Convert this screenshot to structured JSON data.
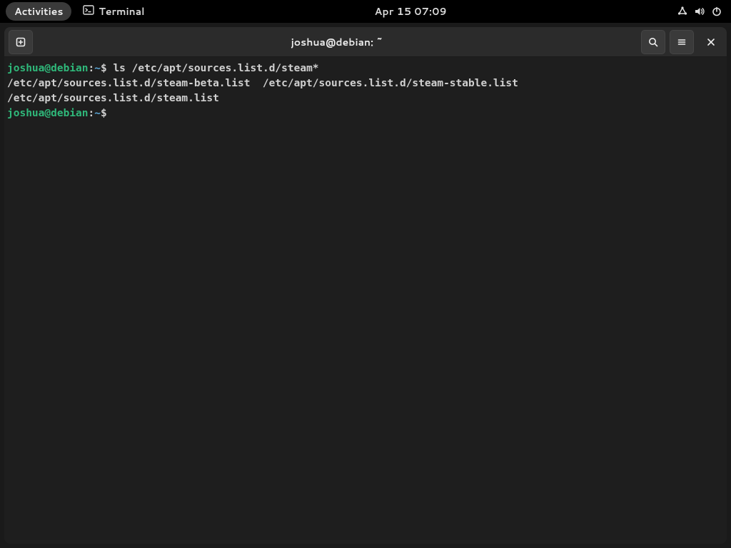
{
  "panel": {
    "activities": "Activities",
    "app_name": "Terminal",
    "clock": "Apr 15  07:09"
  },
  "window": {
    "title": "joshua@debian: ~"
  },
  "prompt": {
    "user": "joshua",
    "at": "@",
    "host": "debian",
    "colon": ":",
    "path": "~",
    "dollar": "$"
  },
  "session": {
    "lines": [
      {
        "type": "prompt",
        "cmd": " ls /etc/apt/sources.list.d/steam*"
      },
      {
        "type": "output",
        "text": "/etc/apt/sources.list.d/steam-beta.list  /etc/apt/sources.list.d/steam-stable.list"
      },
      {
        "type": "output",
        "text": "/etc/apt/sources.list.d/steam.list"
      },
      {
        "type": "prompt",
        "cmd": ""
      }
    ]
  }
}
